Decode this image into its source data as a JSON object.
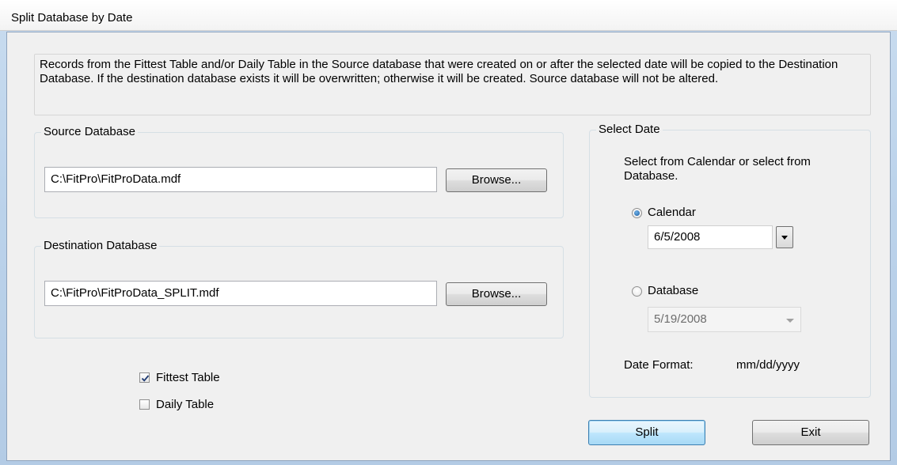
{
  "window": {
    "title": "Split Database by Date"
  },
  "info": {
    "text": "Records from the Fittest Table and/or Daily Table in the Source database that were created on or after the selected date will be copied to the Destination Database. If the destination database exists it will be overwritten; otherwise it will be created. Source database will not be altered."
  },
  "source": {
    "label": "Source Database",
    "path": "C:\\FitPro\\FitProData.mdf",
    "browse_label": "Browse..."
  },
  "destination": {
    "label": "Destination Database",
    "path": "C:\\FitPro\\FitProData_SPLIT.mdf",
    "browse_label": "Browse..."
  },
  "tables": {
    "fittest_label": "Fittest Table",
    "fittest_checked": true,
    "daily_label": "Daily Table",
    "daily_checked": false
  },
  "select_date": {
    "label": "Select Date",
    "instructions": "Select from Calendar or select from Database.",
    "calendar_label": "Calendar",
    "calendar_selected": true,
    "calendar_value": "6/5/2008",
    "database_label": "Database",
    "database_selected": false,
    "database_value": "5/19/2008",
    "format_label": "Date Format:",
    "format_value": "mm/dd/yyyy"
  },
  "actions": {
    "split_label": "Split",
    "exit_label": "Exit"
  },
  "icons": {
    "dropdown": "chevron-down-icon",
    "check": "checkmark-icon"
  }
}
